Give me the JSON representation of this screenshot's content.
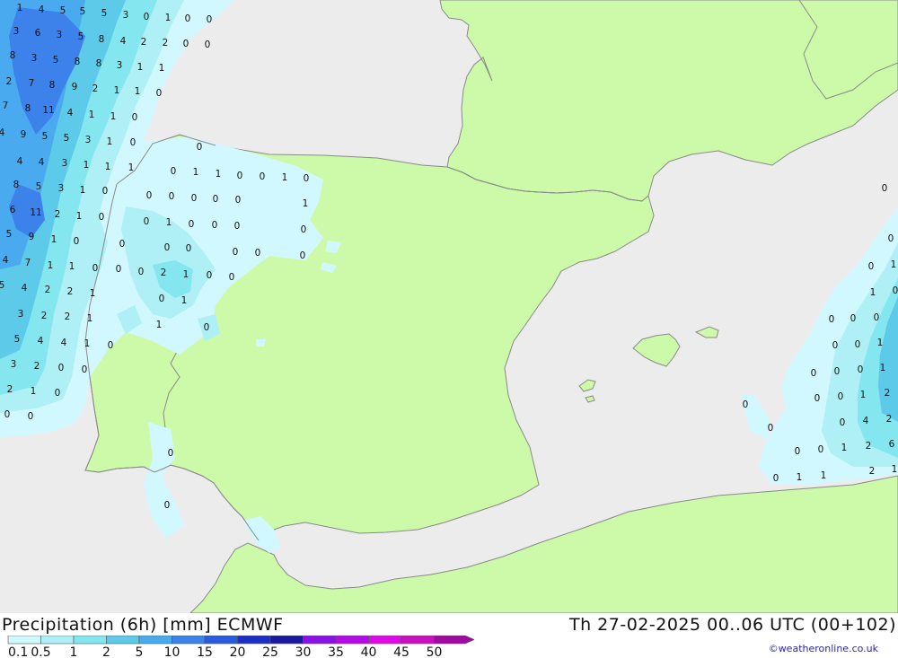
{
  "header": {
    "title": "Precipitation (6h) [mm] ECMWF",
    "datetime": "Th 27-02-2025 00..06 UTC (00+102)"
  },
  "credit": "©weatheronline.co.uk",
  "colors": {
    "sea": "#ececec",
    "land": "#ccfaa9",
    "coast": "#8a8a8a"
  },
  "legend": {
    "ticks": [
      "0.1",
      "0.5",
      "1",
      "2",
      "5",
      "10",
      "15",
      "20",
      "25",
      "30",
      "35",
      "40",
      "45",
      "50"
    ],
    "colors": [
      "#d2f8ff",
      "#aef0f6",
      "#84e6ee",
      "#5ccae8",
      "#4aaaf0",
      "#3d82ea",
      "#2a5ae0",
      "#1c2ec8",
      "#1a1aa0",
      "#8a12e8",
      "#b40ae8",
      "#e00ae8",
      "#c810c0",
      "#a00aa0"
    ]
  },
  "map_values": [
    [
      "1",
      22,
      8
    ],
    [
      "4",
      46,
      10
    ],
    [
      "5",
      70,
      11
    ],
    [
      "5",
      92,
      12
    ],
    [
      "5",
      116,
      14
    ],
    [
      "3",
      140,
      16
    ],
    [
      "0",
      163,
      18
    ],
    [
      "1",
      187,
      19
    ],
    [
      "0",
      209,
      20
    ],
    [
      "0",
      233,
      21
    ],
    [
      "3",
      18,
      34
    ],
    [
      "6",
      42,
      36
    ],
    [
      "3",
      66,
      38
    ],
    [
      "5",
      90,
      40
    ],
    [
      "8",
      113,
      43
    ],
    [
      "4",
      137,
      45
    ],
    [
      "2",
      160,
      46
    ],
    [
      "2",
      184,
      47
    ],
    [
      "0",
      207,
      48
    ],
    [
      "0",
      231,
      49
    ],
    [
      "8",
      14,
      61
    ],
    [
      "3",
      38,
      64
    ],
    [
      "5",
      62,
      66
    ],
    [
      "8",
      86,
      68
    ],
    [
      "8",
      110,
      70
    ],
    [
      "3",
      133,
      72
    ],
    [
      "1",
      156,
      74
    ],
    [
      "1",
      180,
      75
    ],
    [
      "2",
      10,
      90
    ],
    [
      "7",
      35,
      92
    ],
    [
      "8",
      58,
      94
    ],
    [
      "9",
      83,
      96
    ],
    [
      "2",
      106,
      98
    ],
    [
      "1",
      130,
      100
    ],
    [
      "1",
      153,
      101
    ],
    [
      "0",
      177,
      103
    ],
    [
      "7",
      6,
      117
    ],
    [
      "8",
      31,
      120
    ],
    [
      "11",
      54,
      122
    ],
    [
      "4",
      78,
      125
    ],
    [
      "1",
      102,
      127
    ],
    [
      "1",
      126,
      129
    ],
    [
      "0",
      150,
      130
    ],
    [
      "4",
      2,
      147
    ],
    [
      "9",
      26,
      149
    ],
    [
      "5",
      50,
      151
    ],
    [
      "5",
      74,
      153
    ],
    [
      "3",
      98,
      155
    ],
    [
      "1",
      122,
      157
    ],
    [
      "0",
      148,
      158
    ],
    [
      "0",
      222,
      163
    ],
    [
      "4",
      22,
      179
    ],
    [
      "4",
      46,
      180
    ],
    [
      "3",
      72,
      181
    ],
    [
      "1",
      96,
      183
    ],
    [
      "1",
      120,
      185
    ],
    [
      "1",
      146,
      186
    ],
    [
      "8",
      18,
      205
    ],
    [
      "5",
      43,
      207
    ],
    [
      "3",
      68,
      209
    ],
    [
      "1",
      92,
      211
    ],
    [
      "0",
      117,
      212
    ],
    [
      "0",
      193,
      190
    ],
    [
      "1",
      218,
      191
    ],
    [
      "1",
      243,
      193
    ],
    [
      "0",
      267,
      195
    ],
    [
      "0",
      292,
      196
    ],
    [
      "1",
      317,
      197
    ],
    [
      "0",
      341,
      198
    ],
    [
      "6",
      14,
      233
    ],
    [
      "11",
      40,
      236
    ],
    [
      "2",
      64,
      238
    ],
    [
      "1",
      88,
      240
    ],
    [
      "0",
      113,
      241
    ],
    [
      "0",
      166,
      217
    ],
    [
      "0",
      191,
      218
    ],
    [
      "0",
      216,
      220
    ],
    [
      "0",
      240,
      221
    ],
    [
      "0",
      265,
      222
    ],
    [
      "1",
      340,
      226
    ],
    [
      "5",
      10,
      260
    ],
    [
      "9",
      35,
      263
    ],
    [
      "1",
      60,
      266
    ],
    [
      "0",
      85,
      268
    ],
    [
      "0",
      163,
      246
    ],
    [
      "1",
      188,
      247
    ],
    [
      "0",
      213,
      249
    ],
    [
      "0",
      239,
      250
    ],
    [
      "0",
      264,
      251
    ],
    [
      "0",
      338,
      255
    ],
    [
      "4",
      6,
      289
    ],
    [
      "7",
      31,
      292
    ],
    [
      "1",
      56,
      295
    ],
    [
      "1",
      80,
      296
    ],
    [
      "0",
      106,
      298
    ],
    [
      "0",
      132,
      299
    ],
    [
      "0",
      136,
      271
    ],
    [
      "0",
      186,
      275
    ],
    [
      "0",
      210,
      276
    ],
    [
      "0",
      262,
      280
    ],
    [
      "0",
      287,
      281
    ],
    [
      "0",
      337,
      284
    ],
    [
      "5",
      2,
      317
    ],
    [
      "4",
      27,
      320
    ],
    [
      "2",
      53,
      322
    ],
    [
      "2",
      78,
      324
    ],
    [
      "1",
      103,
      326
    ],
    [
      "0",
      157,
      302
    ],
    [
      "2",
      182,
      303
    ],
    [
      "1",
      207,
      305
    ],
    [
      "0",
      233,
      306
    ],
    [
      "0",
      258,
      308
    ],
    [
      "3",
      23,
      349
    ],
    [
      "2",
      49,
      351
    ],
    [
      "2",
      75,
      352
    ],
    [
      "1",
      100,
      354
    ],
    [
      "0",
      180,
      332
    ],
    [
      "1",
      205,
      334
    ],
    [
      "5",
      19,
      377
    ],
    [
      "4",
      45,
      379
    ],
    [
      "4",
      71,
      381
    ],
    [
      "1",
      97,
      382
    ],
    [
      "0",
      123,
      384
    ],
    [
      "1",
      177,
      361
    ],
    [
      "0",
      230,
      364
    ],
    [
      "3",
      15,
      405
    ],
    [
      "2",
      41,
      407
    ],
    [
      "0",
      68,
      409
    ],
    [
      "0",
      94,
      411
    ],
    [
      "2",
      11,
      433
    ],
    [
      "1",
      37,
      435
    ],
    [
      "0",
      64,
      437
    ],
    [
      "0",
      8,
      461
    ],
    [
      "0",
      34,
      463
    ],
    [
      "0",
      190,
      504
    ],
    [
      "0",
      186,
      562
    ],
    [
      "0",
      985,
      209
    ],
    [
      "0",
      992,
      265
    ],
    [
      "0",
      970,
      296
    ],
    [
      "1",
      995,
      294
    ],
    [
      "1",
      972,
      325
    ],
    [
      "0",
      997,
      323
    ],
    [
      "0",
      926,
      355
    ],
    [
      "0",
      950,
      354
    ],
    [
      "0",
      976,
      353
    ],
    [
      "0",
      930,
      384
    ],
    [
      "0",
      955,
      383
    ],
    [
      "1",
      980,
      381
    ],
    [
      "0",
      906,
      415
    ],
    [
      "0",
      932,
      413
    ],
    [
      "0",
      958,
      411
    ],
    [
      "1",
      983,
      409
    ],
    [
      "0",
      910,
      443
    ],
    [
      "0",
      936,
      441
    ],
    [
      "1",
      961,
      439
    ],
    [
      "2",
      988,
      437
    ],
    [
      "0",
      830,
      450
    ],
    [
      "0",
      858,
      476
    ],
    [
      "0",
      938,
      470
    ],
    [
      "4",
      964,
      468
    ],
    [
      "2",
      990,
      466
    ],
    [
      "0",
      888,
      502
    ],
    [
      "0",
      914,
      500
    ],
    [
      "1",
      940,
      498
    ],
    [
      "2",
      967,
      496
    ],
    [
      "6",
      993,
      494
    ],
    [
      "0",
      864,
      532
    ],
    [
      "1",
      890,
      531
    ],
    [
      "1",
      917,
      529
    ],
    [
      "2",
      971,
      524
    ],
    [
      "1",
      996,
      522
    ]
  ]
}
